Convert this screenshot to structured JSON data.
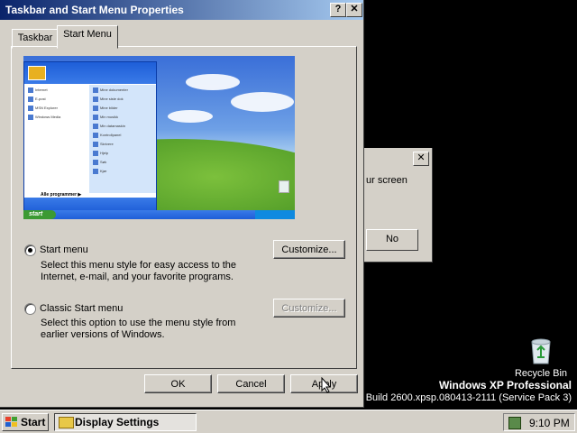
{
  "dialog": {
    "title": "Taskbar and Start Menu Properties",
    "help_label": "?",
    "close_label": "✕",
    "tabs": [
      {
        "label": "Taskbar",
        "selected": false
      },
      {
        "label": "Start Menu",
        "selected": true
      }
    ],
    "options": [
      {
        "label": "Start menu",
        "selected": true,
        "description_lines": [
          "Select this menu style for easy access to the",
          "Internet, e-mail, and your favorite programs."
        ],
        "customize_label": "Customize...",
        "customize_enabled": true
      },
      {
        "label": "Classic Start menu",
        "selected": false,
        "description_lines": [
          "Select this option to use the menu style from",
          "earlier versions of Windows."
        ],
        "customize_label": "Customize...",
        "customize_enabled": false
      }
    ],
    "buttons": {
      "ok": "OK",
      "cancel": "Cancel",
      "apply": "Apply"
    }
  },
  "background_dialog": {
    "close_label": "✕",
    "text": "ur screen",
    "no_label": "No"
  },
  "desktop": {
    "recycle_bin_label": "Recycle Bin",
    "watermark_title": "Windows XP Professional",
    "watermark_build": "Build 2600.xpsp.080413-2111 (Service Pack 3)"
  },
  "taskbar": {
    "start_label": "Start",
    "task_label": "Display Settings",
    "clock": "9:10 PM"
  }
}
